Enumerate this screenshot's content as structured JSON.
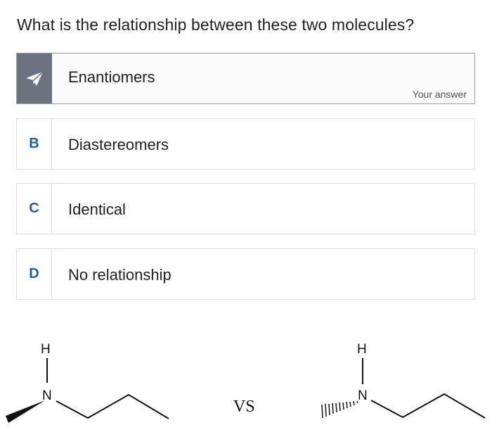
{
  "question": "What is the relationship between these two molecules?",
  "options": [
    {
      "badge": "",
      "label": "Enantiomers",
      "selected": true,
      "note": "Your answer"
    },
    {
      "badge": "B",
      "label": "Diastereomers",
      "selected": false
    },
    {
      "badge": "C",
      "label": "Identical",
      "selected": false
    },
    {
      "badge": "D",
      "label": "No relationship",
      "selected": false
    }
  ],
  "figure": {
    "left_molecule": {
      "atom_h": "H",
      "atom_n": "N"
    },
    "separator": "VS",
    "right_molecule": {
      "atom_h": "H",
      "atom_n": "N"
    }
  },
  "colors": {
    "accent": "#1f5fa8",
    "selected_badge": "#6b7380"
  }
}
